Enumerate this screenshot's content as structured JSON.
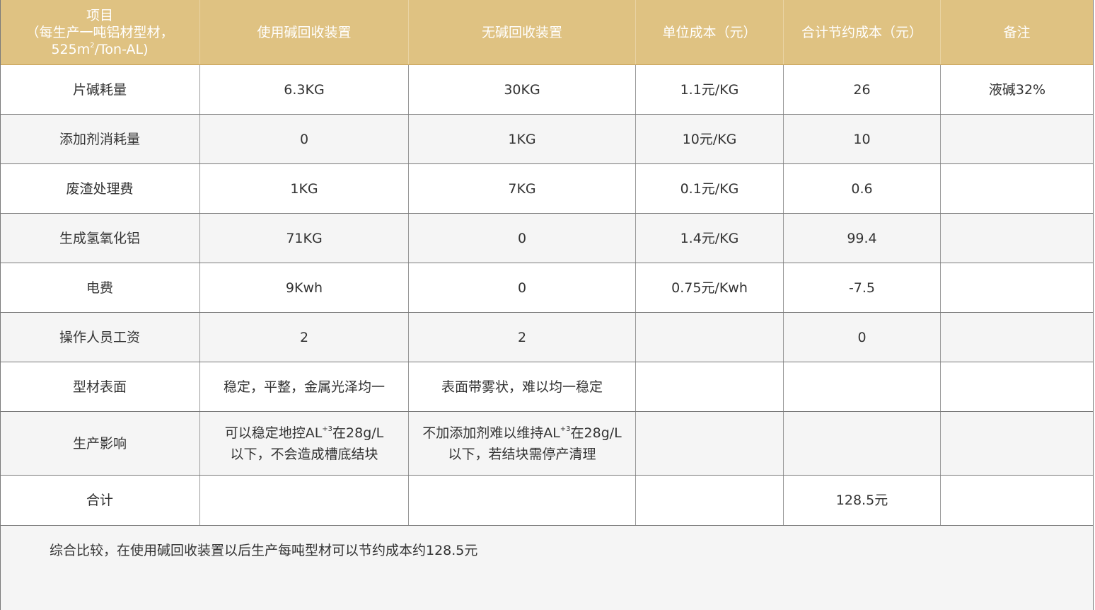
{
  "header": {
    "col1_line1": "项目",
    "col1_line2": "（每生产一吨铝材型材，",
    "col1_line3_pre": "525m",
    "col1_line3_sup": "2",
    "col1_line3_post": "/Ton-AL)",
    "col2": "使用碱回收装置",
    "col3": "无碱回收装置",
    "col4": "单位成本（元）",
    "col5": "合计节约成本（元）",
    "col6": "备注"
  },
  "rows": [
    {
      "item": "片碱耗量",
      "with": "6.3KG",
      "without": "30KG",
      "unit": "1.1元/KG",
      "saving": "26",
      "note": "液碱32%"
    },
    {
      "item": "添加剂消耗量",
      "with": "0",
      "without": "1KG",
      "unit": "10元/KG",
      "saving": "10",
      "note": ""
    },
    {
      "item": "废渣处理费",
      "with": "1KG",
      "without": "7KG",
      "unit": "0.1元/KG",
      "saving": "0.6",
      "note": ""
    },
    {
      "item": "生成氢氧化铝",
      "with": "71KG",
      "without": "0",
      "unit": "1.4元/KG",
      "saving": "99.4",
      "note": ""
    },
    {
      "item": "电费",
      "with": "9Kwh",
      "without": "0",
      "unit": "0.75元/Kwh",
      "saving": "-7.5",
      "note": ""
    },
    {
      "item": "操作人员工资",
      "with": "2",
      "without": "2",
      "unit": "",
      "saving": "0",
      "note": ""
    },
    {
      "item": "型材表面",
      "with": "稳定，平整，金属光泽均一",
      "without": "表面带雾状，难以均一稳定",
      "unit": "",
      "saving": "",
      "note": ""
    }
  ],
  "impact": {
    "item": "生产影响",
    "with_line1_pre": "可以稳定地控AL",
    "with_line1_sup": "+3",
    "with_line1_post": "在28g/L",
    "with_line2": "以下，不会造成槽底结块",
    "without_line1_pre": "不加添加剂难以维持AL",
    "without_line1_sup": "+3",
    "without_line1_post": "在28g/L",
    "without_line2": "以下，若结块需停产清理"
  },
  "total": {
    "item": "合计",
    "saving": "128.5元"
  },
  "summary": "综合比较，在使用碱回收装置以后生产每吨型材可以节约成本约128.5元"
}
